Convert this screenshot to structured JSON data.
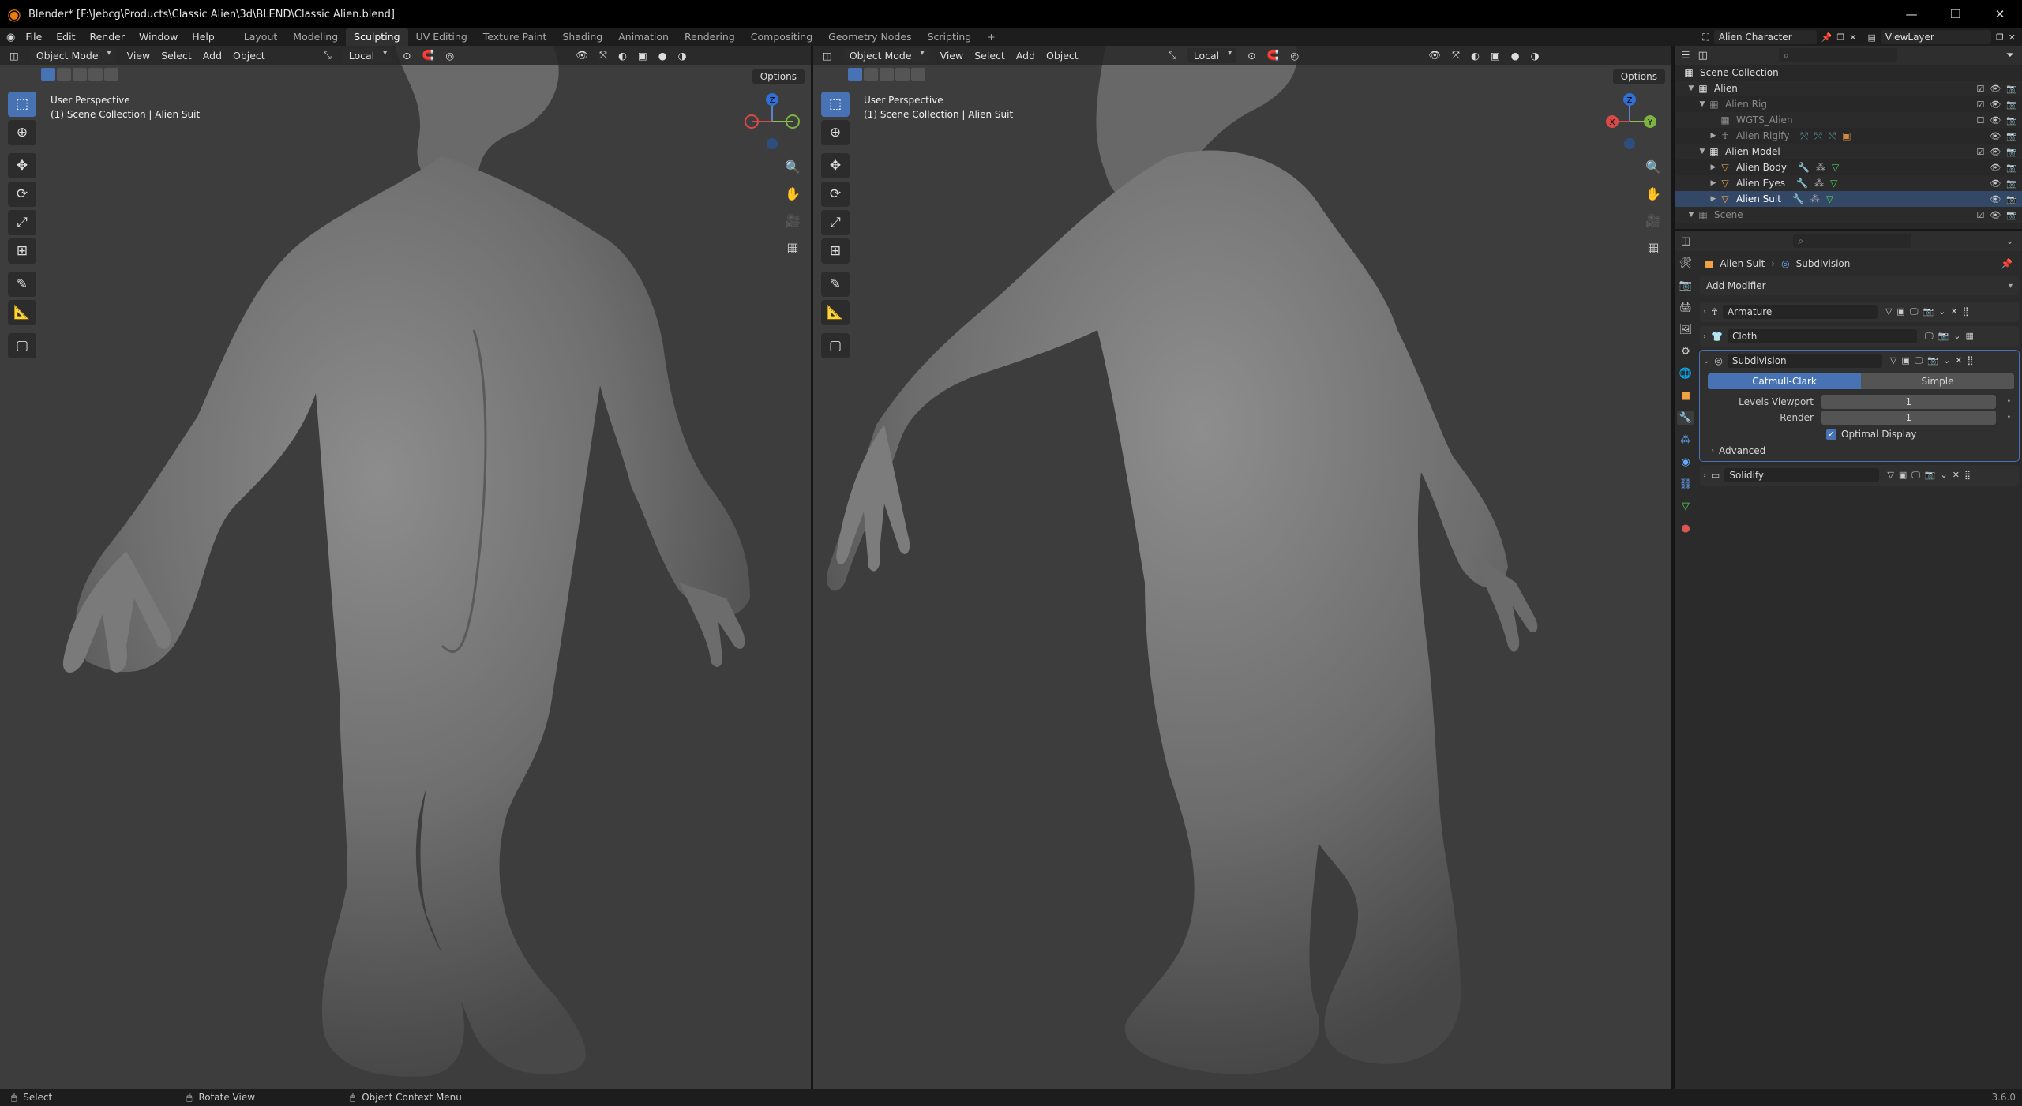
{
  "window": {
    "title": "Blender* [F:\\Jebcg\\Products\\Classic Alien\\3d\\BLEND\\Classic Alien.blend]",
    "controls": [
      "—",
      "❐",
      "✕"
    ]
  },
  "menu": [
    "File",
    "Edit",
    "Render",
    "Window",
    "Help"
  ],
  "workspaces": [
    "Layout",
    "Modeling",
    "Sculpting",
    "UV Editing",
    "Texture Paint",
    "Shading",
    "Animation",
    "Rendering",
    "Compositing",
    "Geometry Nodes",
    "Scripting",
    "+"
  ],
  "active_workspace": "Sculpting",
  "scene_field": "Alien Character",
  "view_layer_field": "ViewLayer",
  "viewport_left": {
    "mode": "Object Mode",
    "menus": [
      "View",
      "Select",
      "Add",
      "Object"
    ],
    "transform": "Local",
    "options_label": "Options",
    "info_line1": "User Perspective",
    "info_line2": "(1) Scene Collection | Alien Suit"
  },
  "viewport_right": {
    "mode": "Object Mode",
    "menus": [
      "View",
      "Select",
      "Add",
      "Object"
    ],
    "transform": "Local",
    "options_label": "Options",
    "info_line1": "User Perspective",
    "info_line2": "(1) Scene Collection | Alien Suit"
  },
  "gizmo_labels": {
    "x": "X",
    "y": "Y",
    "z": "Z"
  },
  "outliner": {
    "rows": [
      {
        "label": "Scene Collection",
        "depth": 0,
        "icon": "▦"
      },
      {
        "label": "Alien",
        "depth": 1,
        "icon": "▦"
      },
      {
        "label": "Alien Rig",
        "depth": 2,
        "icon": "▦"
      },
      {
        "label": "WGTS_Alien",
        "depth": 3,
        "icon": "▦"
      },
      {
        "label": "Alien Rigify",
        "depth": 3,
        "icon": "☥"
      },
      {
        "label": "Alien Model",
        "depth": 2,
        "icon": "▦"
      },
      {
        "label": "Alien Body",
        "depth": 3,
        "icon": "▽"
      },
      {
        "label": "Alien Eyes",
        "depth": 3,
        "icon": "▽"
      },
      {
        "label": "Alien Suit",
        "depth": 3,
        "icon": "▽"
      },
      {
        "label": "Scene",
        "depth": 1,
        "icon": "▦"
      }
    ]
  },
  "properties": {
    "breadcrumb_object": "Alien Suit",
    "breadcrumb_modifier": "Subdivision",
    "add_modifier": "Add Modifier",
    "modifiers": [
      {
        "name": "Armature",
        "expanded": false
      },
      {
        "name": "Cloth",
        "expanded": false
      },
      {
        "name": "Subdivision",
        "expanded": true
      },
      {
        "name": "Solidify",
        "expanded": false
      }
    ],
    "subdiv": {
      "type_a": "Catmull-Clark",
      "type_b": "Simple",
      "levels_viewport_label": "Levels Viewport",
      "levels_viewport": "1",
      "render_label": "Render",
      "render": "1",
      "optimal_display": "Optimal Display",
      "advanced": "Advanced"
    }
  },
  "statusbar": {
    "select": "Select",
    "rotate": "Rotate View",
    "context": "Object Context Menu",
    "version": "3.6.0"
  }
}
